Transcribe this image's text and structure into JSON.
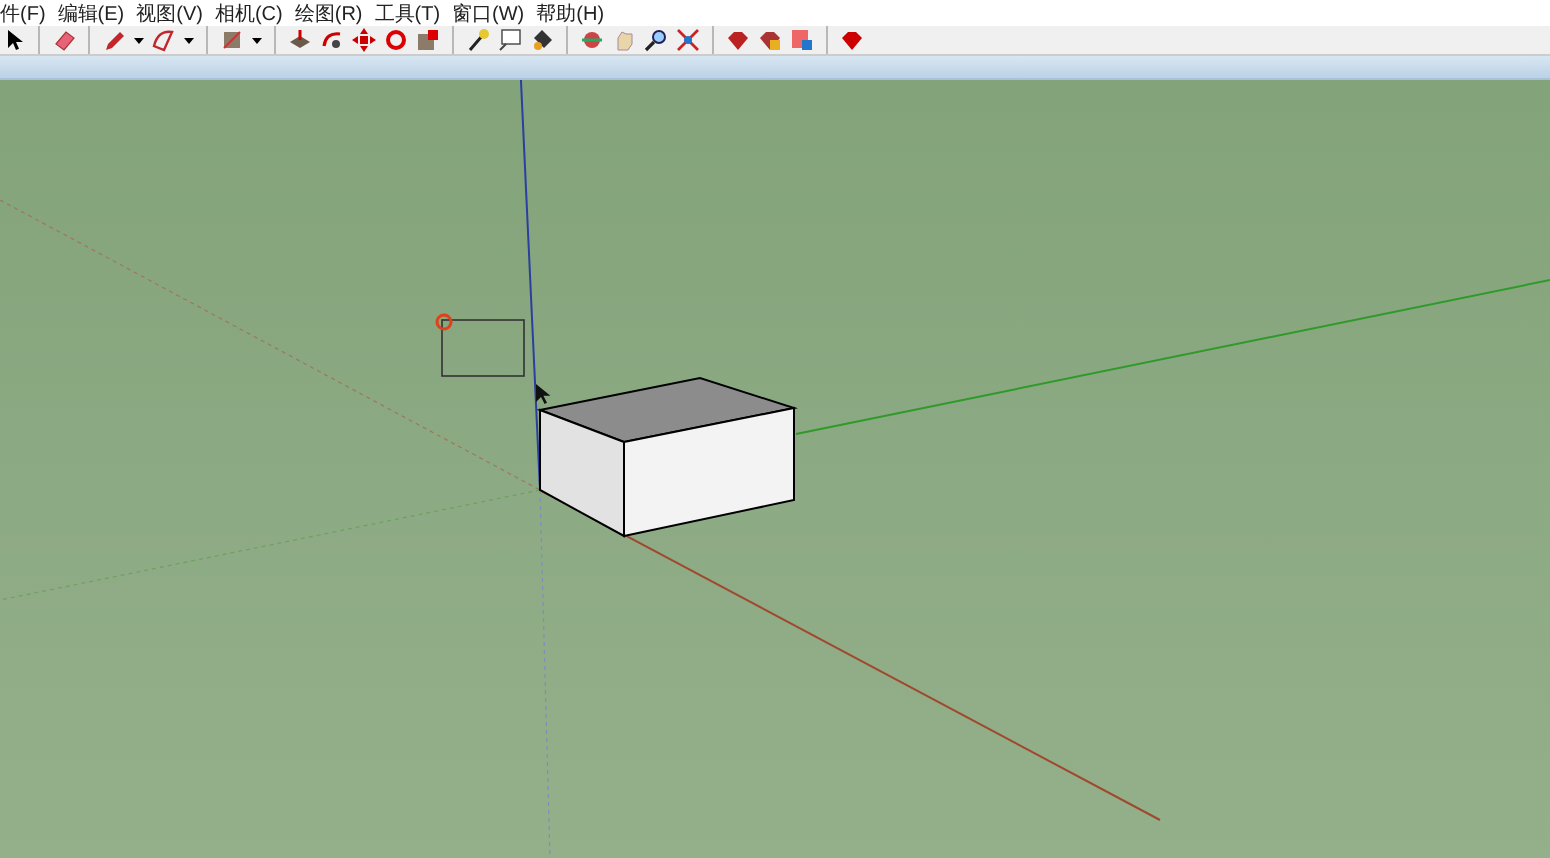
{
  "menu": [
    {
      "label": "件(F)"
    },
    {
      "label": "编辑(E)"
    },
    {
      "label": "视图(V)"
    },
    {
      "label": "相机(C)"
    },
    {
      "label": "绘图(R)"
    },
    {
      "label": "工具(T)"
    },
    {
      "label": "窗口(W)"
    },
    {
      "label": "帮助(H)"
    }
  ]
}
